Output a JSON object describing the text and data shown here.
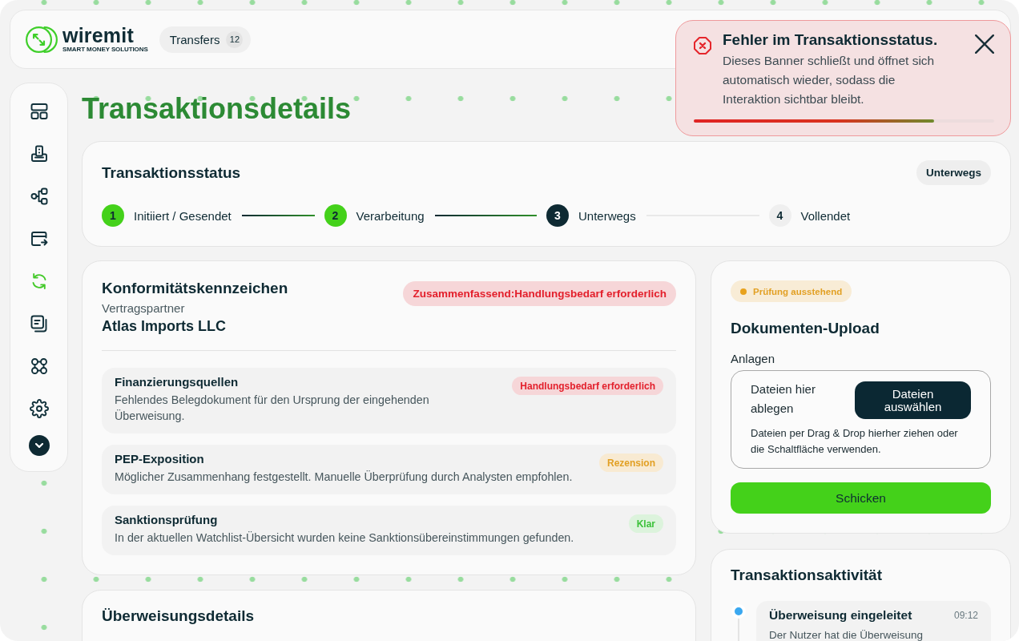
{
  "brand": {
    "name": "wiremit",
    "tagline": "SMART MONEY SOLUTIONS"
  },
  "header": {
    "transfers": {
      "label": "Transfers",
      "count": "12"
    }
  },
  "sidebar": {
    "items": [
      {
        "selected": false
      },
      {
        "selected": false
      },
      {
        "selected": false
      },
      {
        "selected": false
      },
      {
        "selected": true
      },
      {
        "selected": false
      },
      {
        "selected": false
      },
      {
        "selected": false
      }
    ]
  },
  "page_title": "Transaktionsdetails",
  "status": {
    "title": "Transaktionsstatus",
    "badge": "Unterwegs",
    "steps": [
      {
        "number": "1",
        "label": "Initiiert / Gesendet",
        "completed": true,
        "current": false
      },
      {
        "number": "2",
        "label": "Verarbeitung",
        "completed": true,
        "current": false
      },
      {
        "number": "3",
        "label": "Unterwegs",
        "completed": false,
        "current": true
      },
      {
        "number": "4",
        "label": "Vollendet",
        "completed": false,
        "current": false
      }
    ]
  },
  "compliance": {
    "title": "Konformitätskennzeichen",
    "counterparty_label": "Vertragspartner",
    "counterparty": "Atlas Imports LLC",
    "summary": {
      "text": "Zusammenfassend:Handlungsbedarf erforderlich",
      "kind": "action"
    },
    "checks": [
      {
        "title": "Finanzierungsquellen",
        "description": "Fehlendes Belegdokument für den Ursprung der eingehenden Überweisung.",
        "badge": {
          "text": "Handlungsbedarf erforderlich",
          "kind": "action"
        }
      },
      {
        "title": "PEP-Exposition",
        "description": "Möglicher Zusammenhang festgestellt. Manuelle Überprüfung durch Analysten empfohlen.",
        "badge": {
          "text": "Rezension",
          "kind": "review"
        }
      },
      {
        "title": "Sanktionsprüfung",
        "description": "In der aktuellen Watchlist-Übersicht wurden keine Sanktionsübereinstimmungen gefunden.",
        "badge": {
          "text": "Klar",
          "kind": "clear"
        }
      }
    ]
  },
  "transfer_details": {
    "title": "Überweisungsdetails"
  },
  "upload": {
    "status": {
      "text": "Prüfung ausstehend",
      "kind": "pending"
    },
    "title": "Dokumenten-Upload",
    "field_label": "Anlagen",
    "dropzone": {
      "prompt": "Dateien hier ablegen",
      "button": "Dateien auswählen",
      "hint": "Dateien per Drag & Drop hierher ziehen oder die Schaltfläche verwenden."
    },
    "submit": "Schicken"
  },
  "activity": {
    "title": "Transaktionsaktivität",
    "events": [
      {
        "title": "Überweisung eingeleitet",
        "time": "09:12",
        "description": "Der Nutzer hat die Überweisung"
      }
    ]
  },
  "toast": {
    "title": "Fehler im Transaktionsstatus.",
    "message": "Dieses Banner schließt und öffnet sich automatisch wieder, sodass die Interaktion sichtbar bleibt.",
    "progress": {
      "level": 0.8
    }
  }
}
